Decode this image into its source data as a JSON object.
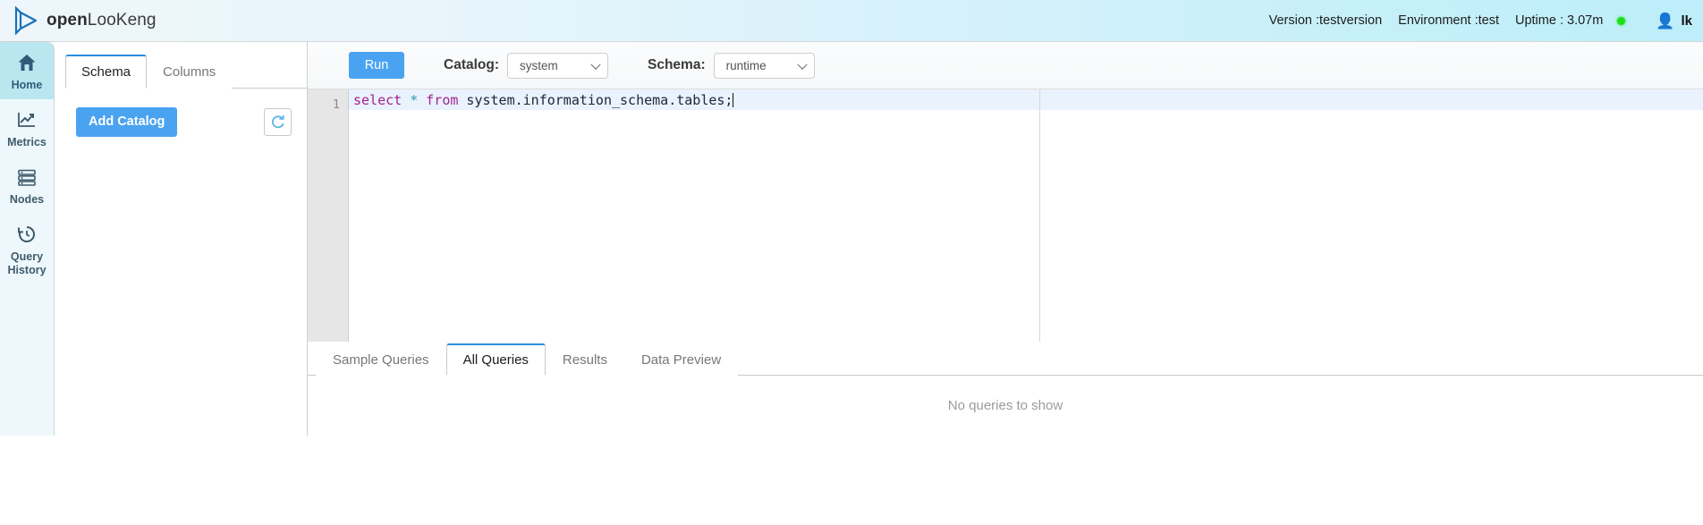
{
  "header": {
    "logo_bold": "open",
    "logo_light": "LooKeng",
    "version": "Version :testversion",
    "environment": "Environment :test",
    "uptime": "Uptime : 3.07m",
    "status_color": "#19e019",
    "user_name": "lk",
    "user_icon": "user-icon"
  },
  "sidebar": {
    "items": [
      {
        "label": "Home",
        "icon": "home-icon",
        "active": true
      },
      {
        "label": "Metrics",
        "icon": "chart-line-icon",
        "active": false
      },
      {
        "label": "Nodes",
        "icon": "server-stack-icon",
        "active": false
      },
      {
        "label": "Query\nHistory",
        "label_line1": "Query",
        "label_line2": "History",
        "icon": "history-clock-icon",
        "active": false
      }
    ]
  },
  "schema_panel": {
    "tabs": [
      {
        "label": "Schema",
        "active": true
      },
      {
        "label": "Columns",
        "active": false
      }
    ],
    "add_catalog_label": "Add Catalog",
    "refresh_icon": "refresh-icon"
  },
  "toolbar": {
    "run_label": "Run",
    "catalog_label": "Catalog:",
    "catalog_value": "system",
    "catalog_options": [
      "system"
    ],
    "schema_label": "Schema:",
    "schema_value": "runtime",
    "schema_options": [
      "runtime"
    ]
  },
  "editor": {
    "line_number": "1",
    "sql": {
      "kw1": "select",
      "star": " * ",
      "kw2": "from",
      "rest": " system.information_schema.tables;"
    },
    "full_text": "select * from system.information_schema.tables;"
  },
  "bottom": {
    "tabs": [
      {
        "label": "Sample Queries",
        "active": false
      },
      {
        "label": "All Queries",
        "active": true
      },
      {
        "label": "Results",
        "active": false
      },
      {
        "label": "Data Preview",
        "active": false
      }
    ],
    "empty_message": "No queries to show"
  },
  "colors": {
    "accent_blue": "#4aa3f0",
    "tab_active_border": "#2a8fe0",
    "header_cyan": "#c6f0fa",
    "sidebar_bg": "#eef8fc",
    "sidebar_active": "#b9e6ef"
  }
}
